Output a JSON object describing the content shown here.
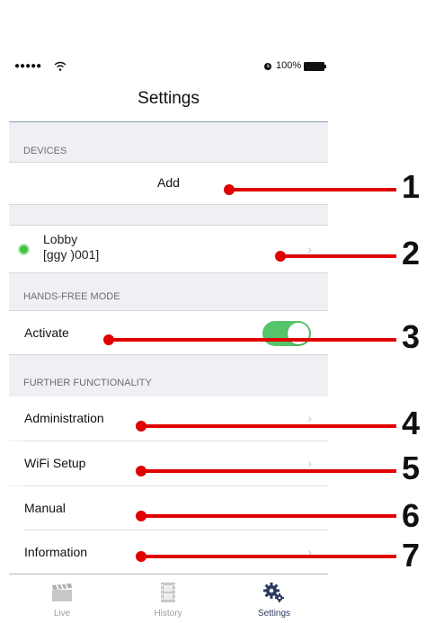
{
  "status_bar": {
    "signal": "●●●●●",
    "battery": "100%"
  },
  "nav": {
    "title": "Settings"
  },
  "devices": {
    "header": "DEVICES",
    "add_label": "Add",
    "device": {
      "name": "Lobby",
      "id": "[ggy      )001]"
    }
  },
  "hands_free": {
    "header": "HANDS-FREE MODE",
    "activate_label": "Activate",
    "toggle_on": true
  },
  "further": {
    "header": "FURTHER FUNCTIONALITY",
    "items": [
      {
        "label": "Administration",
        "chevron": true
      },
      {
        "label": "WiFi Setup",
        "chevron": true
      },
      {
        "label": "Manual",
        "chevron": false
      },
      {
        "label": "Information",
        "chevron": true
      }
    ]
  },
  "chevron_glyph": "›",
  "tabs": [
    {
      "label": "Live",
      "icon": "clapperboard-icon",
      "active": false
    },
    {
      "label": "History",
      "icon": "film-strip-icon",
      "active": false
    },
    {
      "label": "Settings",
      "icon": "gears-icon",
      "active": true
    }
  ],
  "callouts": [
    "1",
    "2",
    "3",
    "4",
    "5",
    "6",
    "7"
  ],
  "colors": {
    "callout_red": "#e00000",
    "toggle_green": "#56c46a",
    "status_green": "#3cc33c",
    "active_tab": "#2b3a63"
  }
}
